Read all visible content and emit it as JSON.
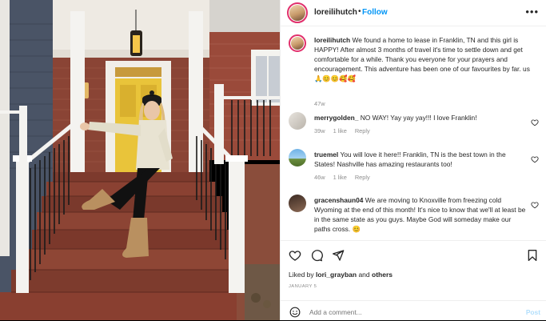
{
  "post": {
    "username": "loreilihutch",
    "follow_label": "Follow",
    "separator": "•",
    "more_label": "•••",
    "caption": "We found a home to lease in Franklin, TN and this girl is HAPPY! After almost 3 months of travel it's time to settle down and get comfortable for a while. Thank you everyone for your prayers and encouragement. This adventure has been one of our favourites by far. us🙏😊😊🥰🥰",
    "caption_age": "47w"
  },
  "comments": [
    {
      "username": "merrygolden_",
      "text": "NO WAY! Yay yay yay!!! I love Franklin!",
      "age": "39w",
      "likes": "1 like",
      "reply_label": "Reply"
    },
    {
      "username": "truemel",
      "text": "You will love it here!! Franklin, TN is the best town in the States! Nashville has amazing restaurants too!",
      "age": "46w",
      "likes": "1 like",
      "reply_label": "Reply"
    },
    {
      "username": "gracenshaun04",
      "text": "We are moving to Knoxville from freezing cold Wyoming at the end of this month! It's nice to know that we'll at least be in the same state as you guys. Maybe God will someday make our paths cross. 😊",
      "age": "",
      "likes": "",
      "reply_label": ""
    }
  ],
  "footer": {
    "liked_prefix": "Liked by",
    "liked_user": "lori_grayban",
    "liked_and": "and",
    "liked_others": "others",
    "date": "JANUARY 5",
    "comment_placeholder": "Add a comment...",
    "post_label": "Post"
  },
  "colors": {
    "accent": "#0095f6",
    "post_disabled": "#b2dffc",
    "muted": "#8e8e8e",
    "text": "#262626",
    "door": "#e9c43a",
    "brick": "#7a3b2e"
  },
  "icons": [
    "heart-icon",
    "comment-icon",
    "share-icon",
    "bookmark-icon",
    "emoji-icon",
    "more-icon"
  ]
}
